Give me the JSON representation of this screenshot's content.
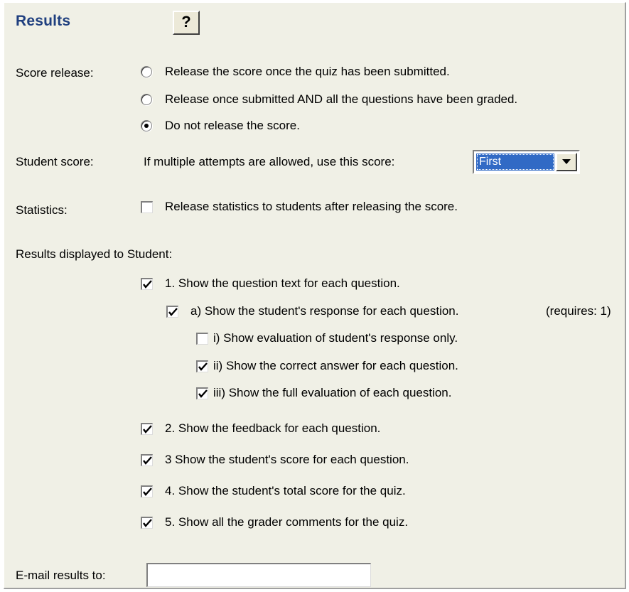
{
  "title": "Results",
  "help_button": {
    "label": "?",
    "icon": "help-icon"
  },
  "score_release": {
    "label": "Score release:",
    "options": [
      {
        "label": "Release the score once the quiz has been submitted.",
        "selected": false
      },
      {
        "label": "Release once submitted  AND all the questions have been graded.",
        "selected": false
      },
      {
        "label": "Do not release the score.",
        "selected": true
      }
    ]
  },
  "student_score": {
    "label": "Student score:",
    "prompt": "If multiple attempts are allowed, use this score:",
    "selected": "First"
  },
  "statistics": {
    "label": "Statistics:",
    "option": {
      "label": "Release statistics to students after releasing the score.",
      "checked": false
    }
  },
  "results_displayed": {
    "heading": "Results displayed to Student:",
    "items": [
      {
        "label": "1. Show the question text for each question.",
        "checked": true
      },
      {
        "label": "a) Show the student's response for each question.",
        "checked": true,
        "note": "(requires: 1)"
      },
      {
        "label": "i) Show evaluation of student's response only.",
        "checked": false
      },
      {
        "label": "ii) Show the correct answer for each question.",
        "checked": true
      },
      {
        "label": "iii) Show the full evaluation of each question.",
        "checked": true
      },
      {
        "label": "2. Show the feedback for each question.",
        "checked": true
      },
      {
        "label": "3 Show the student's score for each question.",
        "checked": true
      },
      {
        "label": "4. Show the student's total score for the quiz.",
        "checked": true
      },
      {
        "label": "5. Show all the grader comments for the quiz.",
        "checked": true
      }
    ]
  },
  "email": {
    "label": "E-mail results to:",
    "value": ""
  },
  "colors": {
    "panel_bg": "#f0f0e6",
    "title": "#1f3f7f",
    "selection": "#316ac5"
  }
}
